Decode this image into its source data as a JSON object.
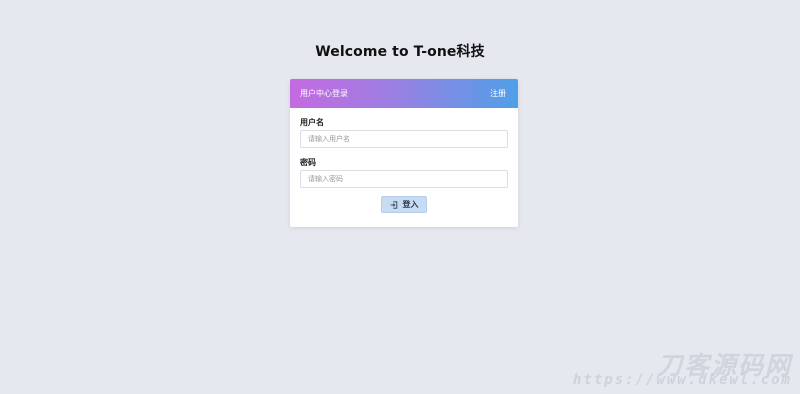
{
  "page": {
    "title": "Welcome to T-one科技"
  },
  "login_card": {
    "header_title": "用户中心登录",
    "register_link": "注册",
    "username": {
      "label": "用户名",
      "placeholder": "请输入用户名",
      "value": ""
    },
    "password": {
      "label": "密码",
      "placeholder": "请输入密码",
      "value": ""
    },
    "login_button": {
      "label": "登入",
      "icon": "sign-in-icon"
    }
  },
  "colors": {
    "background": "#e5e8ef",
    "header_gradient_start": "#c56ae0",
    "header_gradient_end": "#4f9fe8",
    "button_bg": "#c7dcf2"
  },
  "watermark": {
    "brand": "刀客源码网",
    "url": "https://www.dkewl.com"
  }
}
